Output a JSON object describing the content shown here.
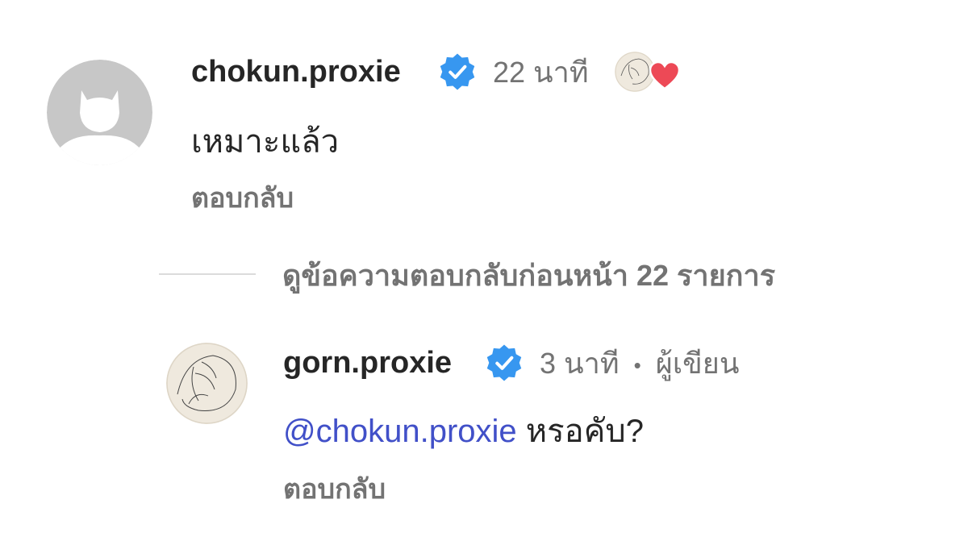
{
  "comment": {
    "username": "chokun.proxie",
    "time": "22 นาที",
    "text": "เหมาะแล้ว",
    "reply_label": "ตอบกลับ"
  },
  "view_more": {
    "label": "ดูข้อความตอบกลับก่อนหน้า 22 รายการ"
  },
  "reply": {
    "username": "gorn.proxie",
    "time": "3 นาที",
    "separator": "•",
    "author_label": "ผู้เขียน",
    "mention": "@chokun.proxie",
    "text": " หรอคับ?",
    "reply_label": "ตอบกลับ"
  },
  "colors": {
    "verified": "#3797f0",
    "mention": "#4150c8",
    "heart": "#ed4956",
    "muted": "#737373"
  }
}
